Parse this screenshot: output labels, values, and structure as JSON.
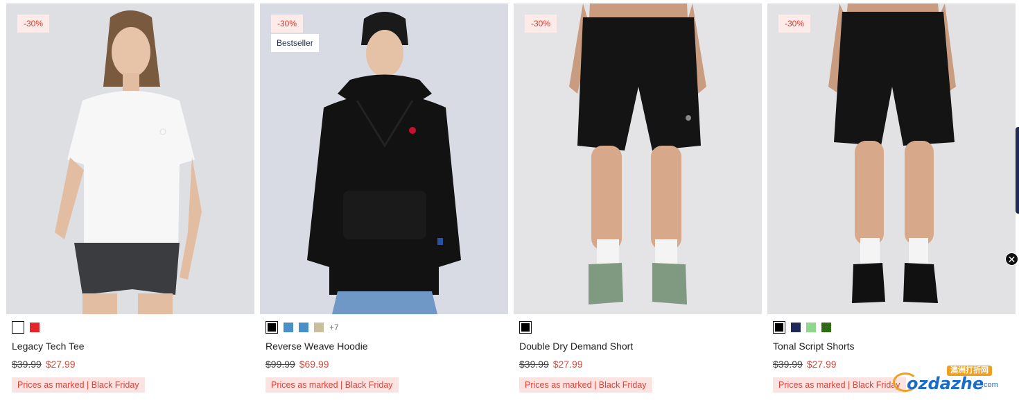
{
  "products": [
    {
      "name": "Legacy Tech Tee",
      "discount_badge": "-30%",
      "tag": "",
      "swatches": [
        "#ffffff",
        "#e3262a"
      ],
      "more_colors": "",
      "was_price": "$39.99",
      "now_price": "$27.99",
      "promo": "Prices as marked | Black Friday"
    },
    {
      "name": "Reverse Weave Hoodie",
      "discount_badge": "-30%",
      "tag": "Bestseller",
      "swatches": [
        "#000000",
        "#4a90c8",
        "#4a90c8",
        "#c9bf9c"
      ],
      "more_colors": "+7",
      "was_price": "$99.99",
      "now_price": "$69.99",
      "promo": "Prices as marked | Black Friday"
    },
    {
      "name": "Double Dry Demand Short",
      "discount_badge": "-30%",
      "tag": "",
      "swatches": [
        "#000000"
      ],
      "more_colors": "",
      "was_price": "$39.99",
      "now_price": "$27.99",
      "promo": "Prices as marked | Black Friday"
    },
    {
      "name": "Tonal Script Shorts",
      "discount_badge": "-30%",
      "tag": "",
      "swatches": [
        "#000000",
        "#1f2a5c",
        "#8fd88a",
        "#2e6b14"
      ],
      "more_colors": "",
      "was_price": "$39.99",
      "now_price": "$27.99",
      "promo": "Prices as marked | Black Friday"
    }
  ],
  "overlay": {
    "close_glyph": "✕",
    "watermark_cn": "澳洲打折网",
    "watermark_main": "ozdazhe",
    "watermark_com": ".com"
  }
}
